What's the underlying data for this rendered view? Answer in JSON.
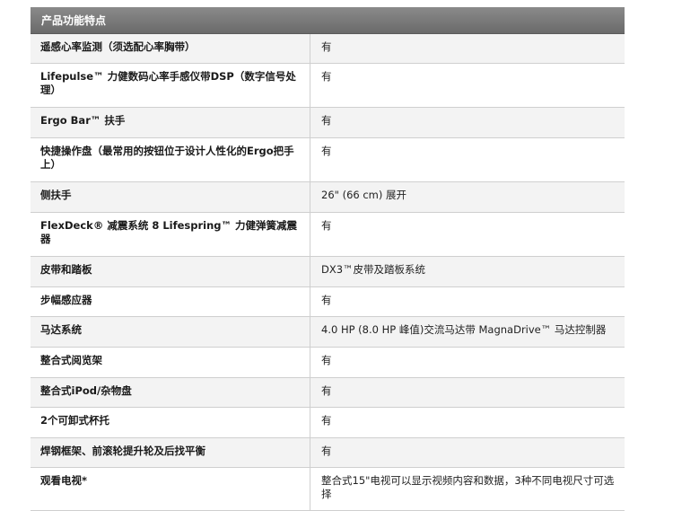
{
  "table": {
    "header": "产品功能特点",
    "rows": [
      {
        "name": "遥感心率监测（须选配心率胸带）",
        "value": "有"
      },
      {
        "name": "Lifepulse™ 力健数码心率手感仪带DSP（数字信号处理）",
        "value": "有"
      },
      {
        "name": "Ergo Bar™ 扶手",
        "value": "有"
      },
      {
        "name": "快捷操作盘（最常用的按钮位于设计人性化的Ergo把手上）",
        "value": "有"
      },
      {
        "name": "侧扶手",
        "value": "26\" (66 cm) 展开"
      },
      {
        "name": "FlexDeck® 减震系统 8 Lifespring™ 力健弹簧减震器",
        "value": "有"
      },
      {
        "name": "皮带和踏板",
        "value": "DX3™皮带及踏板系统"
      },
      {
        "name": "步幅感应器",
        "value": "有"
      },
      {
        "name": "马达系统",
        "value": "4.0 HP (8.0 HP 峰值)交流马达带 MagnaDrive™ 马达控制器"
      },
      {
        "name": "整合式阅览架",
        "value": "有"
      },
      {
        "name": "整合式iPod/杂物盘",
        "value": "有"
      },
      {
        "name": "2个可卸式杯托",
        "value": "有"
      },
      {
        "name": "焊钢框架、前滚轮提升轮及后找平衡",
        "value": "有"
      },
      {
        "name": "观看电视*",
        "value": "整合式15\"电视可以显示视频内容和数据，3种不同电视尺寸可选择"
      }
    ]
  }
}
